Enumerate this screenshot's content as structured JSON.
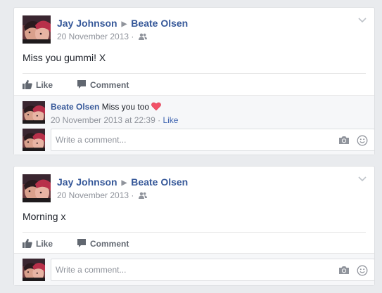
{
  "posts": [
    {
      "author": "Jay Johnson",
      "target": "Beate Olsen",
      "date": "20 November 2013",
      "meta_sep": "·",
      "text": "Miss you gummi! X",
      "like_label": "Like",
      "comment_label": "Comment",
      "comments": [
        {
          "author": "Beate Olsen",
          "text": "Miss you too",
          "timestamp": "20 November 2013 at 22:39",
          "meta_sep": "·",
          "like_label": "Like"
        }
      ],
      "composer_placeholder": "Write a comment..."
    },
    {
      "author": "Jay Johnson",
      "target": "Beate Olsen",
      "date": "20 November 2013",
      "meta_sep": "·",
      "text": "Morning x",
      "like_label": "Like",
      "comment_label": "Comment",
      "composer_placeholder": "Write a comment..."
    }
  ],
  "icons": {
    "arrow": "triangle-right-icon",
    "audience": "friends-icon",
    "menu": "chevron-down-icon",
    "like": "thumbs-up-icon",
    "comment": "speech-bubble-icon",
    "heart": "heart-icon",
    "camera": "camera-icon",
    "emoji": "smiley-icon"
  },
  "colors": {
    "link": "#365899",
    "meta": "#90949c",
    "action": "#616770",
    "background": "#e9ebee",
    "heart": "#f25268"
  }
}
